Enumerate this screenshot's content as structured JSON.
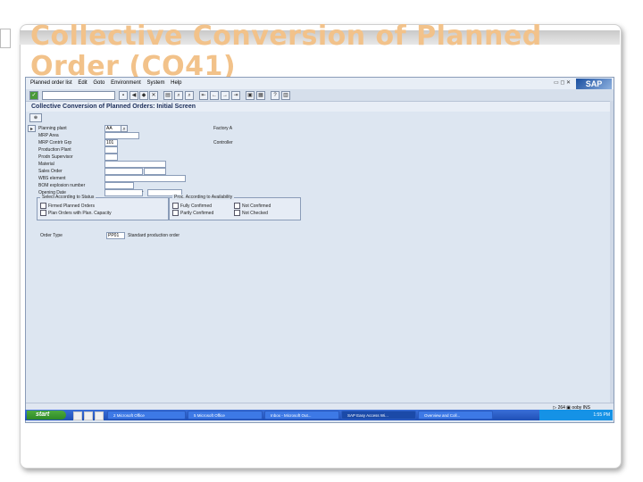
{
  "slide": {
    "title": "Collective Conversion of Planned Order (CO41)"
  },
  "sap": {
    "menu": [
      "Planned order list",
      "Edit",
      "Goto",
      "Environment",
      "System",
      "Help"
    ],
    "screen_title": "Collective Conversion of Planned Orders: Initial Screen",
    "logo": "SAP",
    "fields": [
      {
        "label": "Planning plant",
        "value": "AA",
        "desc": "Factory A"
      },
      {
        "label": "MRP Area",
        "value": "",
        "desc": ""
      },
      {
        "label": "MRP Contrlr Grp",
        "value": "101",
        "desc": "Controller"
      },
      {
        "label": "Production Plant",
        "value": "",
        "desc": ""
      },
      {
        "label": "Prodn Supervisor",
        "value": "",
        "desc": ""
      },
      {
        "label": "Material",
        "value": "",
        "desc": ""
      },
      {
        "label": "Sales Order",
        "value": "",
        "desc": ""
      },
      {
        "label": "WBS element",
        "value": "",
        "desc": ""
      },
      {
        "label": "BOM explosion number",
        "value": "",
        "desc": ""
      },
      {
        "label": "Opening Date",
        "value": "",
        "desc": ""
      }
    ],
    "group_selection": {
      "title": "Select According to Status",
      "options": [
        "Firmed Planned Orders",
        "Plan Orders with Plan. Capacity"
      ]
    },
    "group_availability": {
      "title": "Proc. According to Availability",
      "options": [
        "Fully Confirmed",
        "Not Confirmed",
        "Partly Confirmed",
        "Not Checked"
      ]
    },
    "order_type": {
      "label": "Order Type",
      "value": "PP01",
      "desc": "Standard production order"
    },
    "status": {
      "right": "▷ 264 ▣ ooby INS"
    }
  },
  "taskbar": {
    "start_label": "start",
    "tasks": [
      "2 Microsoft Office",
      "5 Microsoft Office",
      "Inbox - Microsoft Out...",
      "SAP Easy Access Wi...",
      "Overview and Coll..."
    ],
    "clock": "1:55 PM"
  }
}
